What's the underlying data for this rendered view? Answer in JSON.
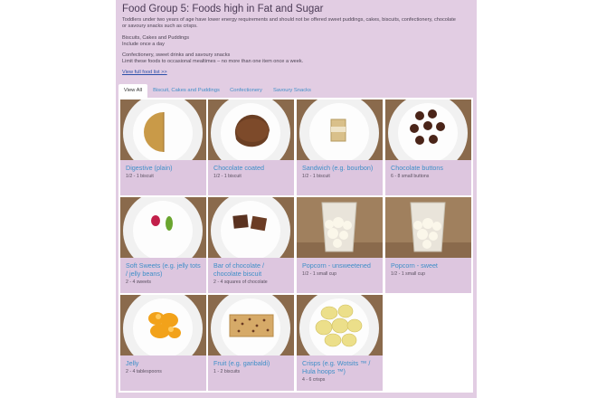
{
  "page": {
    "title": "Food Group 5: Foods high in Fat and Sugar",
    "intro": "Toddlers under two years of age have lower energy requirements and should not be offered sweet puddings, cakes, biscuits, confectionery, chocolate or savoury snacks such as crisps.",
    "sections": [
      {
        "heading": "Biscuits, Cakes and Puddings",
        "text": "Include once a day"
      },
      {
        "heading": "Confectionery, sweet drinks and savoury snacks",
        "text": "Limit these foods to occasional mealtimes – no more than one item once a week."
      }
    ],
    "view_list_link": "View full food list >>"
  },
  "tabs": [
    {
      "label": "View All",
      "active": true
    },
    {
      "label": "Biscuit, Cakes and Puddings",
      "active": false
    },
    {
      "label": "Confectionery",
      "active": false
    },
    {
      "label": "Savoury Snacks",
      "active": false
    }
  ],
  "foods": [
    {
      "name": "Digestive (plain)",
      "qty": "1/2 - 1 biscuit",
      "photo": "digestive-biscuit"
    },
    {
      "name": "Chocolate coated",
      "qty": "1/2 - 1 biscuit",
      "photo": "chocolate-biscuit"
    },
    {
      "name": "Sandwich (e.g. bourbon)",
      "qty": "1/2 - 1 biscuit",
      "photo": "sandwich-biscuit"
    },
    {
      "name": "Chocolate buttons",
      "qty": "6 - 8 small buttons",
      "photo": "chocolate-buttons"
    },
    {
      "name": "Soft Sweets (e.g. jelly tots / jelly beans)",
      "qty": "2 - 4 sweets",
      "photo": "soft-sweets"
    },
    {
      "name": "Bar of chocolate / chocolate biscuit",
      "qty": "2 - 4 squares of chocolate",
      "photo": "chocolate-squares"
    },
    {
      "name": "Popcorn - unsweetened",
      "qty": "1/2 - 1 small cup",
      "photo": "popcorn-cup"
    },
    {
      "name": "Popcorn - sweet",
      "qty": "1/2 - 1 small cup",
      "photo": "popcorn-cup"
    },
    {
      "name": "Jelly",
      "qty": "2 - 4 tablespoons",
      "photo": "orange-jelly"
    },
    {
      "name": "Fruit (e.g. garibaldi)",
      "qty": "1 - 2 biscuits",
      "photo": "garibaldi-biscuit"
    },
    {
      "name": "Crisps (e.g. Wotsits ™ / Hula hoops ™)",
      "qty": "4 - 6 crisps",
      "photo": "crisps"
    }
  ]
}
